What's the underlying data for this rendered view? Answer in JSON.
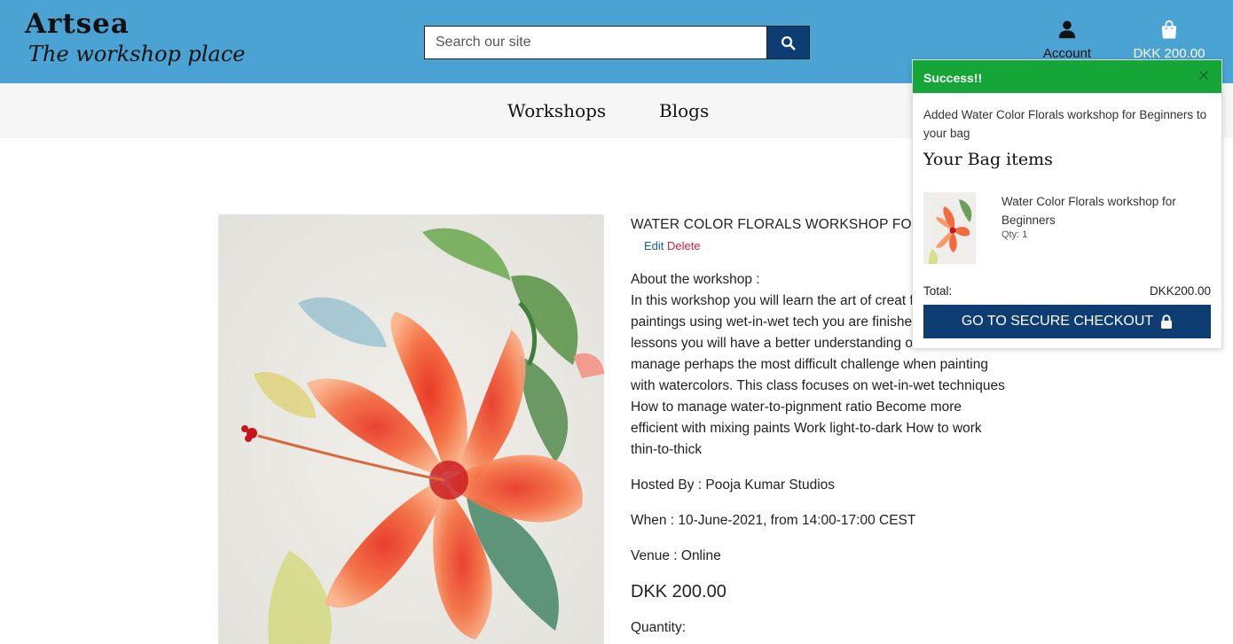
{
  "brand": {
    "name": "Artsea",
    "tagline": "The workshop place"
  },
  "search": {
    "placeholder": "Search our site",
    "icon": "search-icon"
  },
  "account": {
    "label": "Account",
    "icon": "user-icon"
  },
  "bag": {
    "total": "DKK 200.00",
    "icon": "shopping-bag-icon"
  },
  "menu": {
    "items": [
      {
        "label": "Workshops"
      },
      {
        "label": "Blogs"
      }
    ]
  },
  "product": {
    "title": "WATER COLOR FLORALS WORKSHOP FOR",
    "edit_label": "Edit",
    "delete_label": "Delete",
    "about_heading": "About the workshop :",
    "description": "In this workshop you will learn the art of creat flower still life paintings using wet-in-wet tech you are finished with these lessons you will have a better understanding of how to manage perhaps the most difficult challenge when painting with watercolors. This class focuses on wet-in-wet techniques How to manage water-to-pignment ratio Become more efficient with mixing paints Work light-to-dark How to work thin-to-thick",
    "hosted_by": "Hosted By : Pooja Kumar Studios",
    "when": "When : 10-June-2021, from 14:00-17:00 CEST",
    "venue": "Venue : Online",
    "price": "DKK 200.00",
    "quantity_label": "Quantity:"
  },
  "toast": {
    "title": "Success!!",
    "message": "Added Water Color Florals workshop for Beginners to your bag",
    "bag_heading": "Your Bag items",
    "item_name": "Water Color Florals workshop for Beginners",
    "item_qty": "Qty: 1",
    "total_label": "Total:",
    "total_value": "DKK200.00",
    "checkout_label": "GO TO SECURE CHECKOUT",
    "checkout_icon": "lock-icon",
    "close_icon": "close-icon"
  },
  "colors": {
    "header_bg": "#4aa3d3",
    "primary": "#0d3d73",
    "success": "#16a637",
    "delete": "#d9203e",
    "edit": "#1a5fb4"
  }
}
